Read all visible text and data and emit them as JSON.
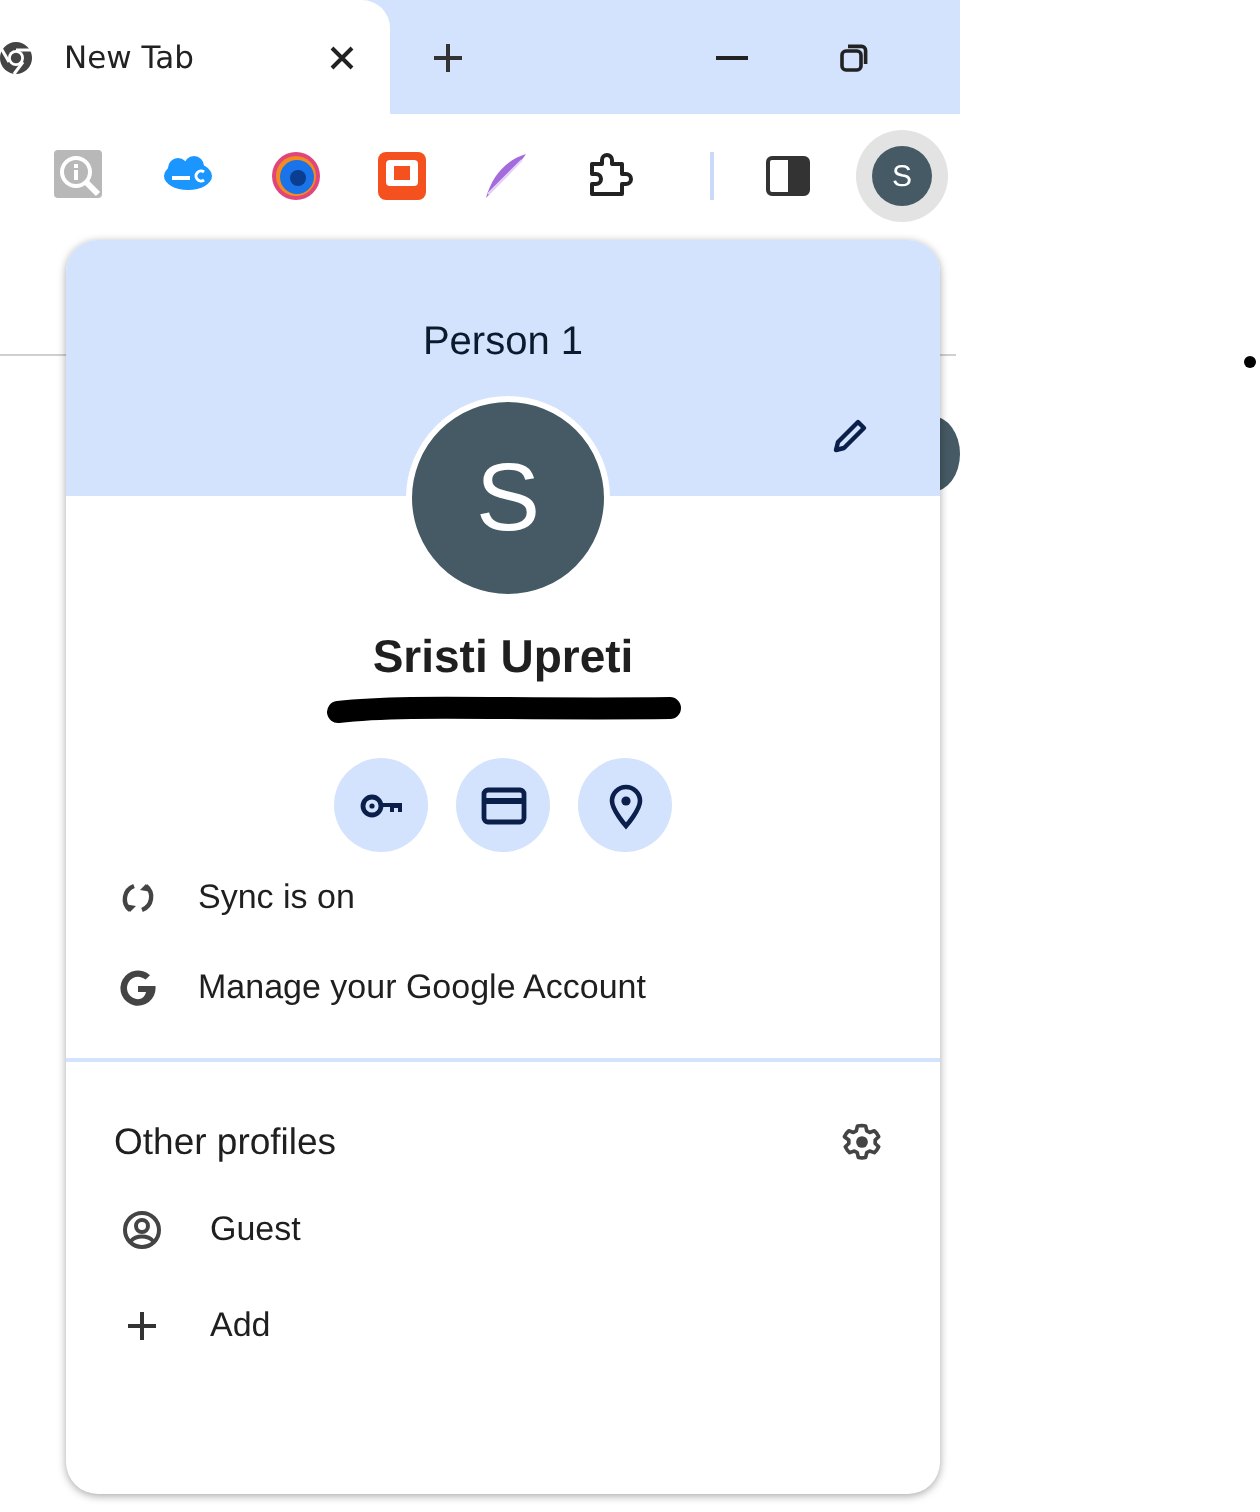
{
  "tabs": [
    {
      "title": "New Tab",
      "selected": true
    }
  ],
  "toolbar": {
    "avatar_initial": "S"
  },
  "profile_menu": {
    "header": "Person 1",
    "avatar_initial": "S",
    "name": "Sristi Upreti",
    "quick_actions": [
      {
        "kind": "key"
      },
      {
        "kind": "card"
      },
      {
        "kind": "location"
      }
    ],
    "items": [
      {
        "kind": "sync",
        "label": "Sync is on"
      },
      {
        "kind": "google",
        "label": "Manage your Google Account"
      }
    ],
    "other_profiles": {
      "title": "Other profiles",
      "items": [
        {
          "kind": "guest",
          "label": "Guest"
        },
        {
          "kind": "add",
          "label": "Add"
        }
      ]
    }
  }
}
